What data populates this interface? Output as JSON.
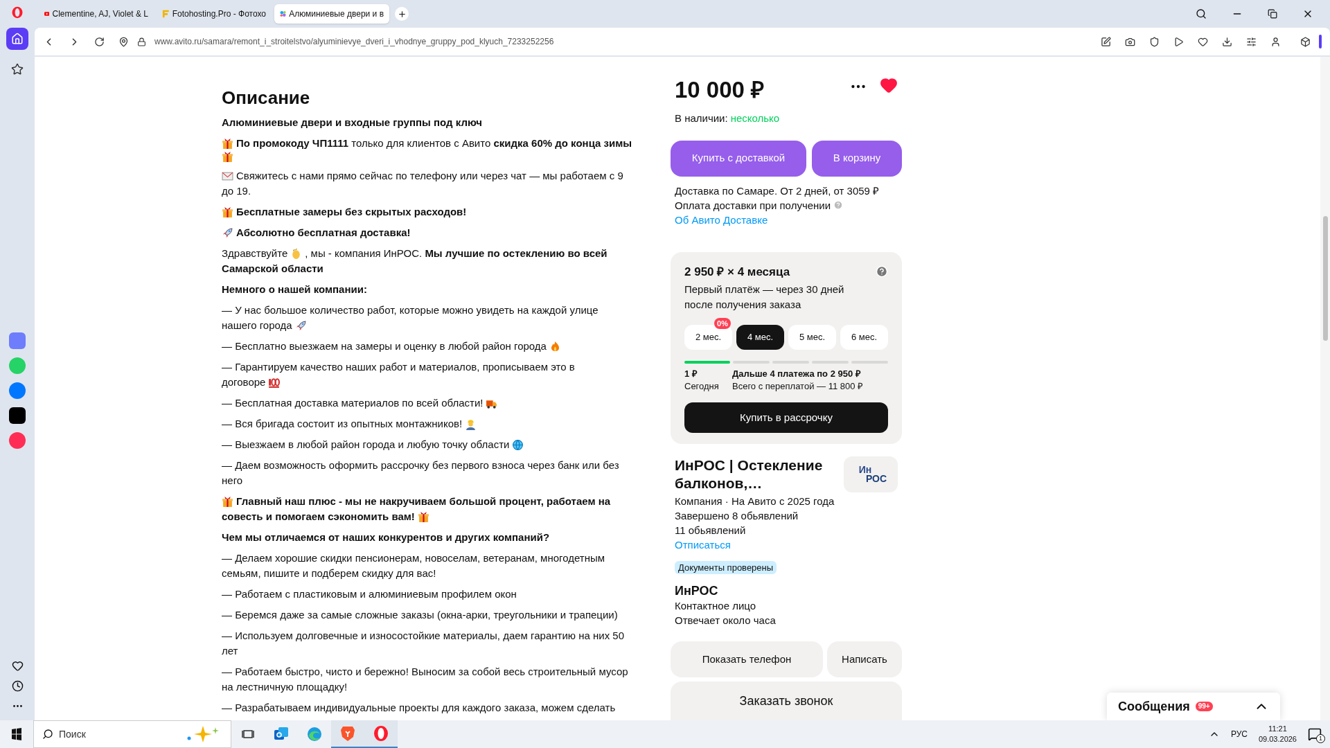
{
  "browser": {
    "tabs": [
      {
        "kind": "video",
        "title": "Clementine, AJ, Violet & L",
        "selected": false
      },
      {
        "kind": "letter",
        "title": "Fotohosting.Pro - Фотохо",
        "selected": false
      },
      {
        "kind": "dots",
        "title": "Алюминиевые двери и в",
        "selected": true
      }
    ],
    "url": "www.avito.ru/samara/remont_i_stroitelstvo/alyuminievye_dveri_i_vhodnye_gruppy_pod_klyuch_7233252256",
    "sidebar": [
      {
        "kind": "home",
        "selected": true
      },
      {
        "kind": "star",
        "selected": false
      }
    ]
  },
  "description": {
    "title": "Описание",
    "paragraphs": [
      {
        "bold": true,
        "lines": [
          [
            {
              "kind": "text",
              "text": "Алюминиевые двери и входные группы под ключ"
            }
          ]
        ]
      },
      {
        "bold": false,
        "lines": [
          [
            {
              "kind": "gift"
            },
            {
              "kind": "text",
              "text": "**По промокоду ЧП1111** только для клиентов с Авито **скидка 60% до конца зимы**"
            }
          ],
          [
            {
              "kind": "gift"
            }
          ]
        ]
      },
      {
        "bold": false,
        "lines": [
          [
            {
              "kind": "envelope"
            },
            {
              "kind": "text",
              "text": "Свяжитесь с нами прямо сейчас по телефону или через чат — мы работаем с 9"
            }
          ],
          [
            {
              "kind": "text",
              "text": "до 19."
            }
          ]
        ]
      },
      {
        "bold": true,
        "lines": [
          [
            {
              "kind": "gift"
            },
            {
              "kind": "text",
              "text": "Бесплатные замеры без скрытых расходов!"
            }
          ]
        ]
      },
      {
        "bold": true,
        "lines": [
          [
            {
              "kind": "rocket"
            },
            {
              "kind": "text",
              "text": "Абсолютно бесплатная доставка!"
            }
          ]
        ]
      },
      {
        "bold": false,
        "lines": [
          [
            {
              "kind": "text",
              "text": "Здравствуйте"
            },
            {
              "kind": "hand"
            },
            {
              "kind": "text",
              "text": ", мы - компания ИнРОС. **Мы лучшие по остеклению во всей**"
            }
          ],
          [
            {
              "kind": "text",
              "text": "**Самарской области**"
            }
          ]
        ]
      },
      {
        "bold": true,
        "lines": [
          [
            {
              "kind": "text",
              "text": "Немного о нашей компании:"
            }
          ]
        ]
      },
      {
        "bold": false,
        "lines": [
          [
            {
              "kind": "text",
              "text": "— У нас большое количество работ, которые можно увидеть на каждой улице"
            }
          ],
          [
            {
              "kind": "text",
              "text": "нашего города"
            },
            {
              "kind": "rocket"
            }
          ]
        ]
      },
      {
        "bold": false,
        "lines": [
          [
            {
              "kind": "text",
              "text": "— Бесплатно выезжаем на замеры и оценку в любой район города"
            },
            {
              "kind": "fire"
            }
          ]
        ]
      },
      {
        "bold": false,
        "lines": [
          [
            {
              "kind": "text",
              "text": "— Гарантируем качество наших работ и материалов, прописываем это в"
            }
          ],
          [
            {
              "kind": "text",
              "text": "договоре"
            },
            {
              "kind": "hundred"
            }
          ]
        ]
      },
      {
        "bold": false,
        "lines": [
          [
            {
              "kind": "text",
              "text": "— Бесплатная доставка материалов по всей области!"
            },
            {
              "kind": "truck"
            }
          ]
        ]
      },
      {
        "bold": false,
        "lines": [
          [
            {
              "kind": "text",
              "text": "— Вся бригада состоит из опытных монтажников!"
            },
            {
              "kind": "worker"
            }
          ]
        ]
      },
      {
        "bold": false,
        "lines": [
          [
            {
              "kind": "text",
              "text": "— Выезжаем в любой район города и любую точку области"
            },
            {
              "kind": "globe"
            }
          ]
        ]
      },
      {
        "bold": false,
        "lines": [
          [
            {
              "kind": "text",
              "text": "— Даем возможность оформить рассрочку без первого взноса через банк или без"
            }
          ],
          [
            {
              "kind": "text",
              "text": "него"
            }
          ]
        ]
      },
      {
        "bold": true,
        "lines": [
          [
            {
              "kind": "gift"
            },
            {
              "kind": "text",
              "text": "Главный наш плюс - мы не накручиваем большой процент, работаем на"
            }
          ],
          [
            {
              "kind": "text",
              "text": "совесть и помогаем сэкономить вам!"
            },
            {
              "kind": "gift"
            }
          ]
        ]
      },
      {
        "bold": true,
        "lines": [
          [
            {
              "kind": "text",
              "text": "Чем мы отличаемся от наших конкурентов и других компаний?"
            }
          ]
        ]
      },
      {
        "bold": false,
        "lines": [
          [
            {
              "kind": "text",
              "text": "— Делаем хорошие скидки пенсионерам, новоселам, ветеранам, многодетным"
            }
          ],
          [
            {
              "kind": "text",
              "text": "семьям, пишите и подберем скидку для вас!"
            }
          ]
        ]
      },
      {
        "bold": false,
        "lines": [
          [
            {
              "kind": "text",
              "text": "— Работаем с пластиковым и алюминиевым профилем окон"
            }
          ]
        ]
      },
      {
        "bold": false,
        "lines": [
          [
            {
              "kind": "text",
              "text": "— Беремся даже за самые сложные заказы (окна-арки, треугольники и трапеции)"
            }
          ]
        ]
      },
      {
        "bold": false,
        "lines": [
          [
            {
              "kind": "text",
              "text": "— Используем долговечные и износостойкие материалы, даем гарантию на них 50"
            }
          ],
          [
            {
              "kind": "text",
              "text": "лет"
            }
          ]
        ]
      },
      {
        "bold": false,
        "lines": [
          [
            {
              "kind": "text",
              "text": "— Работаем быстро, чисто и бережно! Выносим за собой весь строительный мусор"
            }
          ],
          [
            {
              "kind": "text",
              "text": "на лестничную площадку!"
            }
          ]
        ]
      },
      {
        "bold": false,
        "lines": [
          [
            {
              "kind": "text",
              "text": "— Разрабатываем индивидуальные проекты для каждого заказа, можем сделать"
            }
          ]
        ]
      }
    ]
  },
  "offer": {
    "price": "10 000 ₽",
    "favorite": true,
    "stock_label": "В наличии:",
    "stock_value": "несколько",
    "buttons": [
      "Купить с доставкой",
      "В корзину"
    ],
    "delivery": [
      "Доставка по Самаре. От 2 дней, от 3059 ₽",
      "Оплата доставки при получении"
    ],
    "delivery_link": "Об Авито Доставке"
  },
  "installment": {
    "title": "2 950 ₽ × 4 месяца",
    "subtitle": "Первый платёж — через 30 дней после получения заказа",
    "terms": [
      {
        "label": "2 мес.",
        "selected": false,
        "badge": "0%"
      },
      {
        "label": "4 мес.",
        "selected": true
      },
      {
        "label": "5 мес.",
        "selected": false
      },
      {
        "label": "6 мес.",
        "selected": false
      }
    ],
    "segments": [
      {
        "paid": true
      },
      {
        "paid": false
      },
      {
        "paid": false
      },
      {
        "paid": false
      },
      {
        "paid": false
      }
    ],
    "today_amount": "1 ₽",
    "today_label": "Сегодня",
    "next_label": "Дальше 4 платежа по 2 950 ₽",
    "total_label": "Всего с переплатой — 11 800 ₽",
    "button": "Купить в рассрочку"
  },
  "seller": {
    "name": "ИнРОС | Остекление балконов,…",
    "logo_lines": [
      "Ин",
      "РОС"
    ],
    "info": [
      "Компания · На Авито с 2025 года",
      "Завершено 8 обьявлений",
      "11 обьявлений"
    ],
    "link": "Отписаться",
    "badge": "Документы проверены",
    "contact_name": "ИнРОС",
    "contact_lines": [
      "Контактное лицо",
      "Отвечает около часа"
    ],
    "buttons": [
      "Показать телефон",
      "Написать"
    ],
    "call_button": "Заказать звонок"
  },
  "messages": {
    "title": "Сообщения",
    "count": "99+"
  },
  "taskbar": {
    "search_placeholder": "Поиск",
    "apps": [
      {
        "kind": "taskview",
        "active": false
      },
      {
        "kind": "mail",
        "active": false
      },
      {
        "kind": "edge",
        "active": false
      },
      {
        "kind": "brave",
        "active": true
      },
      {
        "kind": "opera",
        "active": true
      }
    ],
    "language": "РУС",
    "time": "11:21",
    "date": "09.03.2026",
    "notifications": "1"
  }
}
